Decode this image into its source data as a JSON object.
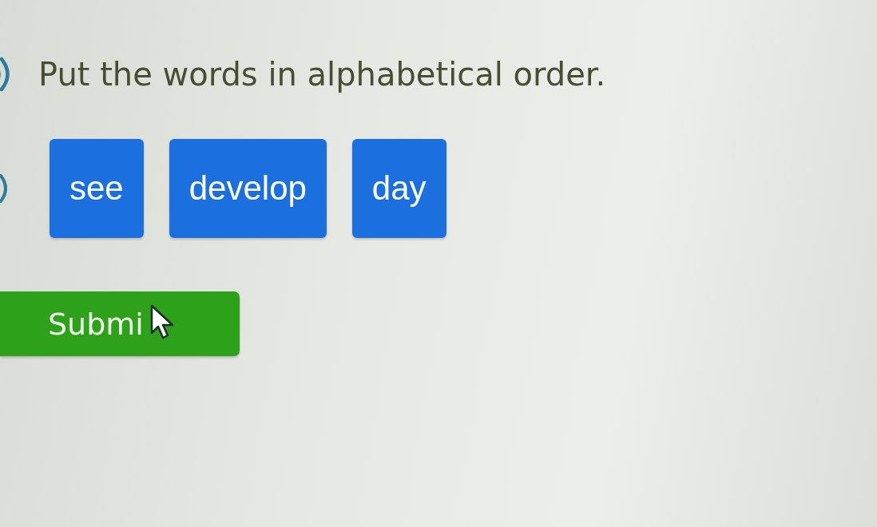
{
  "instruction": {
    "text": "Put the words in alphabetical order."
  },
  "word_tiles": [
    {
      "label": "see"
    },
    {
      "label": "develop"
    },
    {
      "label": "day"
    }
  ],
  "submit_button": {
    "label": "Submi"
  }
}
